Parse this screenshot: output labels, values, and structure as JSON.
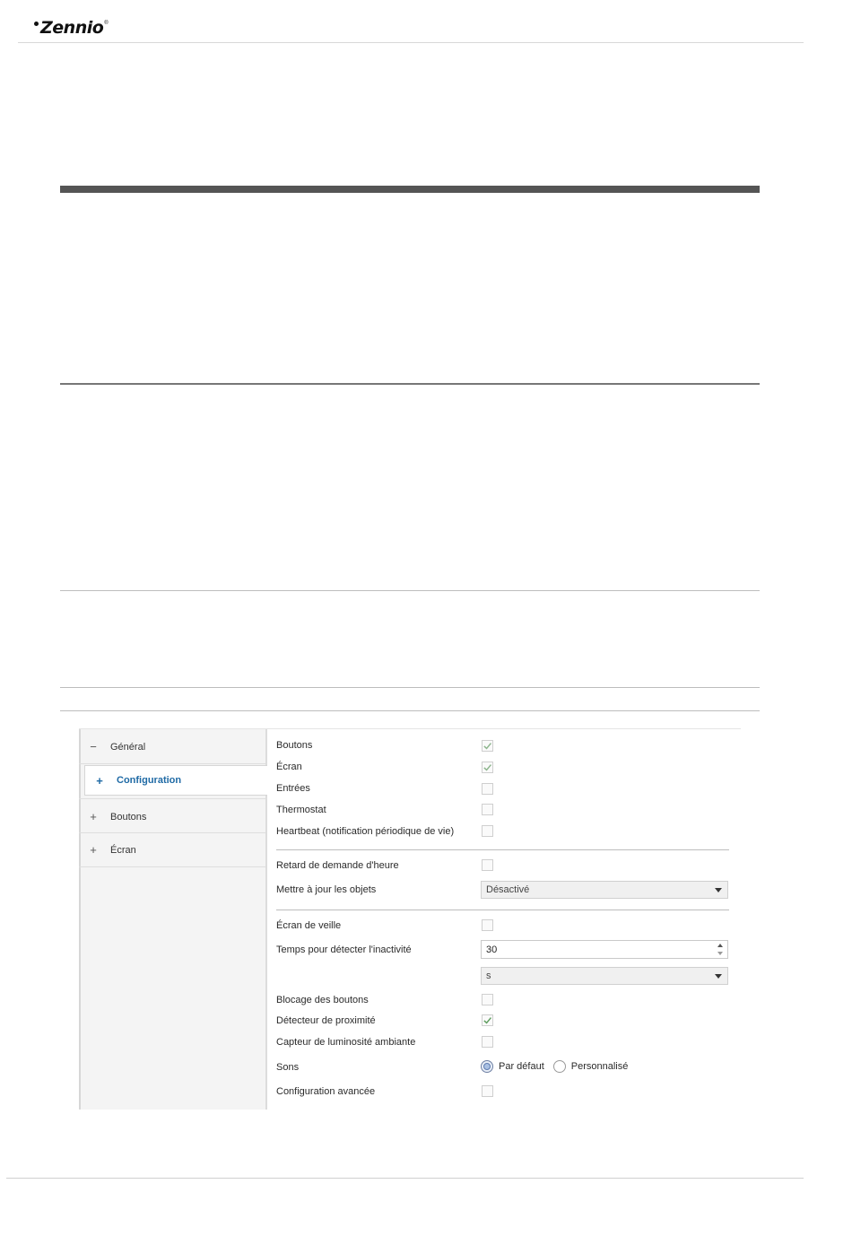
{
  "header": {
    "brand": "Zennio",
    "brand_mark": "®"
  },
  "sidebar": {
    "items": [
      {
        "label": "Général",
        "icon": "minus-icon"
      },
      {
        "label": "Configuration",
        "icon": "plus-icon",
        "selected": true
      },
      {
        "label": "Boutons",
        "icon": "plus-icon"
      },
      {
        "label": "Écran",
        "icon": "plus-icon"
      }
    ]
  },
  "form": {
    "rows": {
      "boutons": {
        "label": "Boutons",
        "checked": true,
        "disabled": true
      },
      "ecran": {
        "label": "Écran",
        "checked": true,
        "disabled": true
      },
      "entrees": {
        "label": "Entrées",
        "checked": false
      },
      "thermostat": {
        "label": "Thermostat",
        "checked": false
      },
      "heartbeat": {
        "label": "Heartbeat (notification périodique de vie)",
        "checked": false
      },
      "retard": {
        "label": "Retard de demande d'heure",
        "checked": false
      },
      "mettre_a_jour": {
        "label": "Mettre à jour les objets",
        "value": "Désactivé"
      },
      "ecran_veille": {
        "label": "Écran de veille",
        "checked": false
      },
      "temps_inactivite": {
        "label": "Temps pour détecter l'inactivité",
        "value": "30",
        "unit": "s"
      },
      "blocage": {
        "label": "Blocage des boutons",
        "checked": false
      },
      "proximite": {
        "label": "Détecteur de proximité",
        "checked": true
      },
      "luminosite": {
        "label": "Capteur de luminosité ambiante",
        "checked": false
      },
      "sons": {
        "label": "Sons",
        "options": [
          "Par défaut",
          "Personnalisé"
        ],
        "selected": "Par défaut"
      },
      "config_avancee": {
        "label": "Configuration avancée",
        "checked": false
      }
    }
  },
  "colors": {
    "accent": "#1f6aa5",
    "check": "#6aa56a"
  }
}
